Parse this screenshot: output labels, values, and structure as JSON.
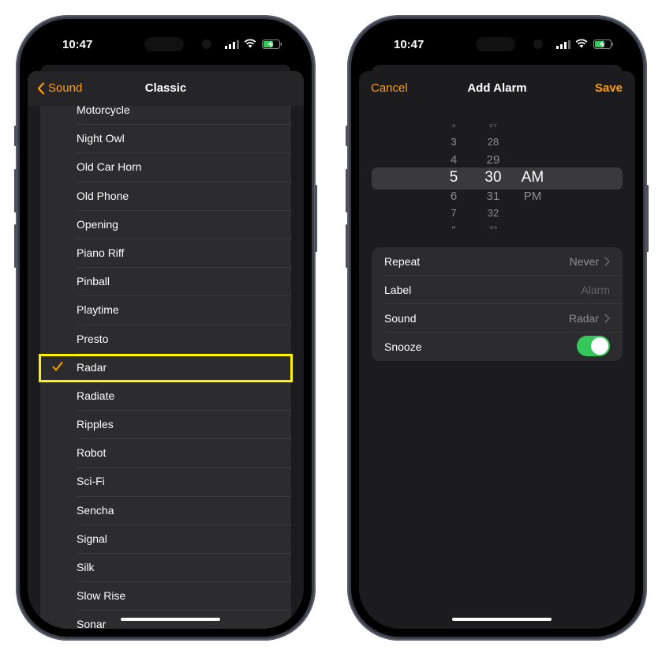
{
  "status_bar": {
    "time": "10:47"
  },
  "left_screen": {
    "nav": {
      "back_label": "Sound",
      "title": "Classic"
    },
    "sounds": [
      {
        "label": "Motorcycle",
        "selected": false
      },
      {
        "label": "Night Owl",
        "selected": false
      },
      {
        "label": "Old Car Horn",
        "selected": false
      },
      {
        "label": "Old Phone",
        "selected": false
      },
      {
        "label": "Opening",
        "selected": false
      },
      {
        "label": "Piano Riff",
        "selected": false
      },
      {
        "label": "Pinball",
        "selected": false
      },
      {
        "label": "Playtime",
        "selected": false
      },
      {
        "label": "Presto",
        "selected": false
      },
      {
        "label": "Radar",
        "selected": true
      },
      {
        "label": "Radiate",
        "selected": false
      },
      {
        "label": "Ripples",
        "selected": false
      },
      {
        "label": "Robot",
        "selected": false
      },
      {
        "label": "Sci-Fi",
        "selected": false
      },
      {
        "label": "Sencha",
        "selected": false
      },
      {
        "label": "Signal",
        "selected": false
      },
      {
        "label": "Silk",
        "selected": false
      },
      {
        "label": "Slow Rise",
        "selected": false
      },
      {
        "label": "Sonar",
        "selected": false
      }
    ],
    "highlight_color": "#fff200"
  },
  "right_screen": {
    "nav": {
      "cancel_label": "Cancel",
      "title": "Add Alarm",
      "save_label": "Save"
    },
    "picker": {
      "hours": [
        "2",
        "3",
        "4",
        "5",
        "6",
        "7",
        "8"
      ],
      "minutes": [
        "27",
        "28",
        "29",
        "30",
        "31",
        "32",
        "33"
      ],
      "periods": [
        "AM",
        "PM"
      ],
      "selected": {
        "hour": "5",
        "minute": "30",
        "period": "AM"
      }
    },
    "settings": {
      "repeat": {
        "label": "Repeat",
        "value": "Never"
      },
      "label": {
        "label": "Label",
        "placeholder": "Alarm"
      },
      "sound": {
        "label": "Sound",
        "value": "Radar"
      },
      "snooze": {
        "label": "Snooze",
        "enabled": true
      }
    }
  },
  "colors": {
    "accent": "#ff9f0a",
    "toggle_on": "#34c759"
  }
}
